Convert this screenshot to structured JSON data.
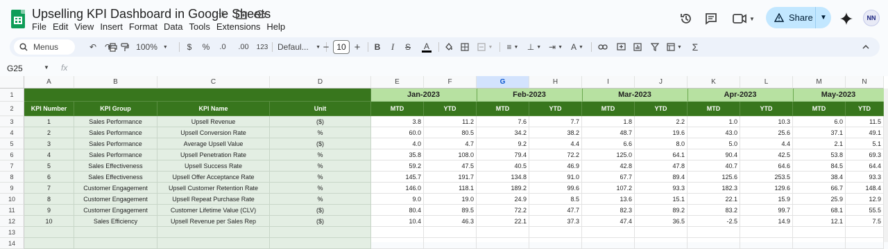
{
  "app": {
    "title": "Upselling KPI Dashboard in Google Sheets",
    "menu": [
      "File",
      "Edit",
      "View",
      "Insert",
      "Format",
      "Data",
      "Tools",
      "Extensions",
      "Help"
    ],
    "share_label": "Share",
    "avatar_initials": "NN"
  },
  "toolbar": {
    "search_label": "Menus",
    "zoom": "100%",
    "currency": "$",
    "percent": "%",
    "decrease_decimals": ".0",
    "increase_decimals": ".00",
    "number_format": "123",
    "font_name": "Defaul...",
    "font_size": "10",
    "bold": "B",
    "text_color": "A"
  },
  "formula_bar": {
    "name_box": "G25",
    "fx": "fx"
  },
  "sheet": {
    "selected_column": "G",
    "columns": [
      "A",
      "B",
      "C",
      "D",
      "E",
      "F",
      "G",
      "H",
      "I",
      "J",
      "K",
      "L",
      "M",
      "N"
    ],
    "rows": [
      "1",
      "2",
      "3",
      "4",
      "5",
      "6",
      "7",
      "8",
      "9",
      "10",
      "11",
      "12",
      "13",
      "14"
    ],
    "headers": [
      "KPI Number",
      "KPI Group",
      "KPI Name",
      "Unit"
    ],
    "months": [
      "Jan-2023",
      "Feb-2023",
      "Mar-2023",
      "Apr-2023",
      "May-2023"
    ],
    "mtd_label": "MTD",
    "ytd_label": "YTD",
    "data": [
      {
        "num": "1",
        "group": "Sales Performance",
        "name": "Upsell Revenue",
        "unit": "($)",
        "values": [
          "3.8",
          "11.2",
          "7.6",
          "7.7",
          "1.8",
          "2.2",
          "1.0",
          "10.3",
          "6.0",
          "11.5"
        ]
      },
      {
        "num": "2",
        "group": "Sales Performance",
        "name": "Upsell Conversion Rate",
        "unit": "%",
        "values": [
          "60.0",
          "80.5",
          "34.2",
          "38.2",
          "48.7",
          "19.6",
          "43.0",
          "25.6",
          "37.1",
          "49.1"
        ]
      },
      {
        "num": "3",
        "group": "Sales Performance",
        "name": "Average Upsell Value",
        "unit": "($)",
        "values": [
          "4.0",
          "4.7",
          "9.2",
          "4.4",
          "6.6",
          "8.0",
          "5.0",
          "4.4",
          "2.1",
          "5.1"
        ]
      },
      {
        "num": "4",
        "group": "Sales Performance",
        "name": "Upsell Penetration Rate",
        "unit": "%",
        "values": [
          "35.8",
          "108.0",
          "79.4",
          "72.2",
          "125.0",
          "64.1",
          "90.4",
          "42.5",
          "53.8",
          "69.3"
        ]
      },
      {
        "num": "5",
        "group": "Sales Effectiveness",
        "name": "Upsell Success Rate",
        "unit": "%",
        "values": [
          "59.2",
          "47.5",
          "40.5",
          "46.9",
          "42.8",
          "47.8",
          "40.7",
          "64.6",
          "84.5",
          "64.4"
        ]
      },
      {
        "num": "6",
        "group": "Sales Effectiveness",
        "name": "Upsell Offer Acceptance Rate",
        "unit": "%",
        "values": [
          "145.7",
          "191.7",
          "134.8",
          "91.0",
          "67.7",
          "89.4",
          "125.6",
          "253.5",
          "38.4",
          "93.3"
        ]
      },
      {
        "num": "7",
        "group": "Customer Engagement",
        "name": "Upsell Customer Retention Rate",
        "unit": "%",
        "values": [
          "146.0",
          "118.1",
          "189.2",
          "99.6",
          "107.2",
          "93.3",
          "182.3",
          "129.6",
          "66.7",
          "148.4"
        ]
      },
      {
        "num": "8",
        "group": "Customer Engagement",
        "name": "Upsell Repeat Purchase Rate",
        "unit": "%",
        "values": [
          "9.0",
          "19.0",
          "24.9",
          "8.5",
          "13.6",
          "15.1",
          "22.1",
          "15.9",
          "25.9",
          "12.9"
        ]
      },
      {
        "num": "9",
        "group": "Customer Engagement",
        "name": "Customer Lifetime Value (CLV)",
        "unit": "($)",
        "values": [
          "80.4",
          "89.5",
          "72.2",
          "47.7",
          "82.3",
          "89.2",
          "83.2",
          "99.7",
          "68.1",
          "55.5"
        ]
      },
      {
        "num": "10",
        "group": "Sales Efficiency",
        "name": "Upsell Revenue per Sales Rep",
        "unit": "($)",
        "values": [
          "10.4",
          "46.3",
          "22.1",
          "37.3",
          "47.4",
          "36.5",
          "-2.5",
          "14.9",
          "12.1",
          "7.5"
        ]
      }
    ]
  }
}
